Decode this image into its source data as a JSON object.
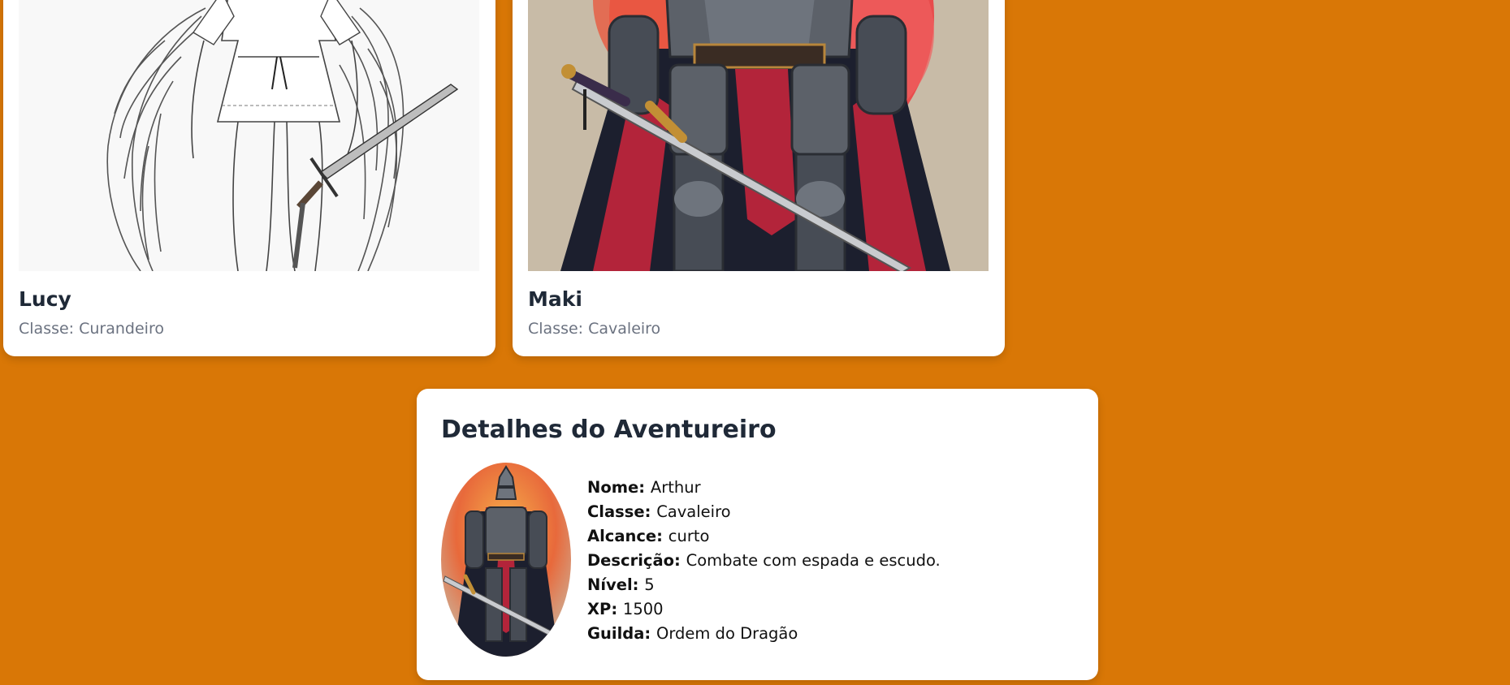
{
  "cards": [
    {
      "name": "Lucy",
      "class_text": "Classe: Curandeiro",
      "image_icon": "winged-healer-illustration"
    },
    {
      "name": "Maki",
      "class_text": "Classe: Cavaleiro",
      "image_icon": "armored-knight-illustration"
    }
  ],
  "details": {
    "title": "Detalhes do Aventureiro",
    "avatar_icon": "knight-avatar",
    "fields": [
      {
        "label": "Nome:",
        "value": "Arthur"
      },
      {
        "label": "Classe:",
        "value": "Cavaleiro"
      },
      {
        "label": "Alcance:",
        "value": "curto"
      },
      {
        "label": "Descrição:",
        "value": "Combate com espada e escudo."
      },
      {
        "label": "Nível:",
        "value": "5"
      },
      {
        "label": "XP:",
        "value": "1500"
      },
      {
        "label": "Guilda:",
        "value": "Ordem do Dragão"
      }
    ]
  },
  "colors": {
    "page_background": "#d97706",
    "card_background": "#ffffff",
    "heading_text": "#1f2937",
    "secondary_text": "#6b7280"
  }
}
